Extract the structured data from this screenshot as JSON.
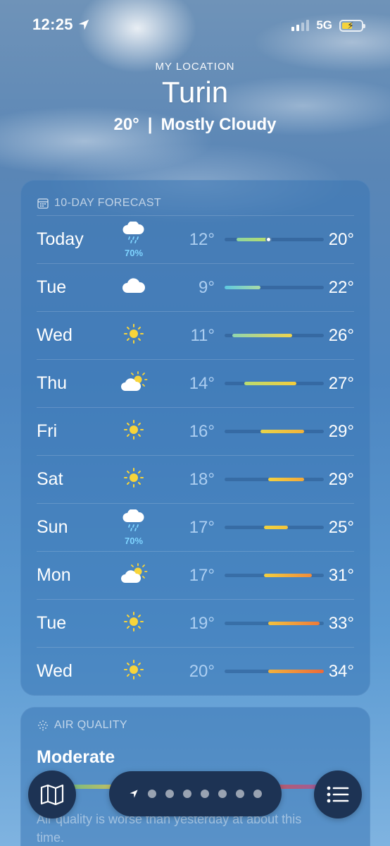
{
  "status_bar": {
    "time": "12:25",
    "network": "5G",
    "battery_level": 0.55,
    "icons": [
      "location-arrow-icon",
      "signal-icon",
      "battery-charging-icon"
    ]
  },
  "header": {
    "location_label": "MY LOCATION",
    "city": "Turin",
    "current_temp": "20°",
    "separator": "|",
    "condition": "Mostly Cloudy"
  },
  "forecast": {
    "title": "10-DAY FORECAST",
    "icon": "calendar-icon",
    "scale_min": 9,
    "scale_max": 34,
    "days": [
      {
        "day": "Today",
        "icon": "rain-cloud-icon",
        "precip": "70%",
        "low": "12°",
        "high": "20°",
        "low_val": 12,
        "high_val": 20,
        "current_val": 20,
        "colors": [
          "#8fd6a0",
          "#b8dc6a"
        ]
      },
      {
        "day": "Tue",
        "icon": "cloud-icon",
        "precip": "",
        "low": "9°",
        "high": "22°",
        "low_val": 9,
        "high_val": 18,
        "colors": [
          "#5ec8e0",
          "#a9dba6"
        ]
      },
      {
        "day": "Wed",
        "icon": "sun-icon",
        "precip": "",
        "low": "11°",
        "high": "26°",
        "low_val": 11,
        "high_val": 26,
        "colors": [
          "#8fd6b0",
          "#f0d44c"
        ]
      },
      {
        "day": "Thu",
        "icon": "partly-cloudy-icon",
        "precip": "",
        "low": "14°",
        "high": "27°",
        "low_val": 14,
        "high_val": 27,
        "colors": [
          "#b9dc72",
          "#f4cc3c"
        ]
      },
      {
        "day": "Fri",
        "icon": "sun-icon",
        "precip": "",
        "low": "16°",
        "high": "29°",
        "low_val": 18,
        "high_val": 29,
        "colors": [
          "#e8d54a",
          "#f2b23a"
        ]
      },
      {
        "day": "Sat",
        "icon": "sun-icon",
        "precip": "",
        "low": "18°",
        "high": "29°",
        "low_val": 20,
        "high_val": 29,
        "colors": [
          "#f2d140",
          "#f2a83a"
        ]
      },
      {
        "day": "Sun",
        "icon": "rain-cloud-icon",
        "precip": "70%",
        "low": "17°",
        "high": "25°",
        "low_val": 19,
        "high_val": 25,
        "colors": [
          "#f0d240",
          "#f2c43c"
        ]
      },
      {
        "day": "Mon",
        "icon": "partly-cloudy-icon",
        "precip": "",
        "low": "17°",
        "high": "31°",
        "low_val": 19,
        "high_val": 31,
        "colors": [
          "#f2d040",
          "#f08a3a"
        ]
      },
      {
        "day": "Tue",
        "icon": "sun-icon",
        "precip": "",
        "low": "19°",
        "high": "33°",
        "low_val": 20,
        "high_val": 33,
        "colors": [
          "#f2c23e",
          "#ee7a3a"
        ]
      },
      {
        "day": "Wed",
        "icon": "sun-icon",
        "precip": "",
        "low": "20°",
        "high": "34°",
        "low_val": 20,
        "high_val": 34,
        "colors": [
          "#f2b23c",
          "#ec6a3a"
        ]
      }
    ]
  },
  "air_quality": {
    "title": "AIR QUALITY",
    "icon": "air-quality-icon",
    "value": "Moderate",
    "description": "Air quality is worse than yesterday at about this time."
  },
  "toolbar": {
    "map_icon": "map-icon",
    "list_icon": "list-icon",
    "location_icon": "location-arrow-icon",
    "page_count": 7
  }
}
